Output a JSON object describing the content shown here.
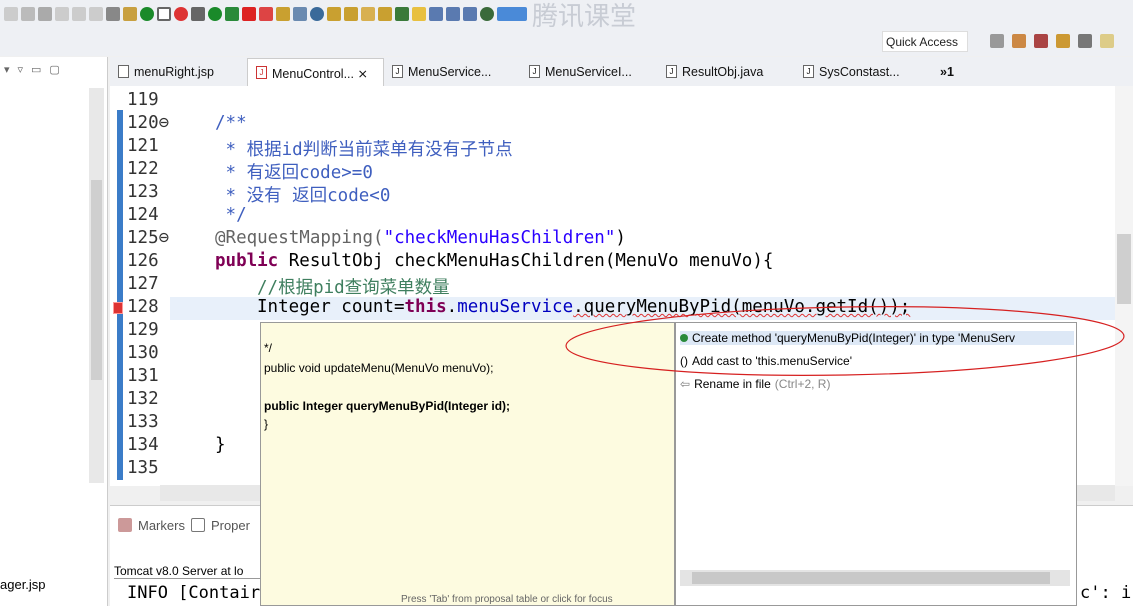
{
  "toolbar": {
    "quick_access": "Quick Access",
    "watermark": "腾讯课堂"
  },
  "tabs": [
    {
      "label": "menuRight.jsp",
      "icon": "jsp-file-icon"
    },
    {
      "label": "MenuControl... ⨯",
      "icon": "java-error-file-icon",
      "active": true
    },
    {
      "label": "MenuService...",
      "icon": "java-file-icon"
    },
    {
      "label": "MenuServiceI...",
      "icon": "java-file-icon"
    },
    {
      "label": "ResultObj.java",
      "icon": "java-file-icon"
    },
    {
      "label": "SysConstast...",
      "icon": "java-file-icon"
    }
  ],
  "overflow_tabs": "»1",
  "editor": {
    "line_numbers": [
      "119",
      "120⊖",
      "121",
      "122",
      "123",
      "124",
      "125⊖",
      "126",
      "127",
      "128",
      "129",
      "130",
      "131",
      "132",
      "133",
      "134",
      "135"
    ],
    "lines": {
      "l120": "/**",
      "l121": " * 根据id判断当前菜单有没有子节点",
      "l122": " * 有返回code>=0",
      "l123": " * 没有 返回code<0",
      "l124": " */",
      "l125a": "@RequestMapping(",
      "l125b": "\"checkMenuHasChildren\"",
      "l125c": ")",
      "l126a": "public",
      "l126b": " ResultObj checkMenuHasChildren(MenuVo menuVo){",
      "l127": "//根据pid查询菜单数量",
      "l128a": "Integer count=",
      "l128b": "this",
      "l128c": ".",
      "l128d": "menuService",
      "l128e": ".queryMenuByPid(menuVo.getId());",
      "l134": "}"
    }
  },
  "popup": {
    "doc_lines": [
      "*/",
      "public void updateMenu(MenuVo menuVo);",
      "public Integer queryMenuByPid(Integer id);",
      "}"
    ],
    "footer": "Press 'Tab' from proposal table or click for focus",
    "proposals": [
      {
        "label": "Create method 'queryMenuByPid(Integer)' in type 'MenuServ",
        "icon": "green-dot-icon",
        "selected": true
      },
      {
        "label": "Add cast to 'this.menuService'",
        "icon": "cast-icon"
      },
      {
        "label": "Rename in file",
        "shortcut": "(Ctrl+2, R)",
        "icon": "rename-icon"
      }
    ]
  },
  "bottom": {
    "markers_tab": "Markers",
    "properties_tab": "Proper",
    "console_title": "Tomcat v8.0 Server at lo",
    "console_line": "INFO [Contair",
    "console_right": "c': i"
  },
  "left_panel": {
    "file": "ager.jsp"
  },
  "colors": {
    "keyword": "#7f0055",
    "string": "#2a00ff",
    "comment": "#3f5fbf",
    "field": "#0000c0",
    "annotation_circle": "#d62020"
  }
}
